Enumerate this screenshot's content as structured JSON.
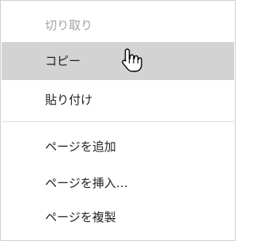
{
  "context_menu": {
    "items": [
      {
        "label": "切り取り",
        "state": "disabled"
      },
      {
        "label": "コピー",
        "state": "hover"
      },
      {
        "label": "貼り付け",
        "state": "normal"
      },
      {
        "label": "ページを追加",
        "state": "normal"
      },
      {
        "label": "ページを挿入…",
        "state": "normal"
      },
      {
        "label": "ページを複製",
        "state": "normal"
      }
    ]
  },
  "cursor": {
    "icon": "hand-pointer-icon"
  },
  "colors": {
    "hover_background": "#d3d3d3",
    "disabled_text": "#a3a3a3",
    "text": "#222222",
    "border": "#cfcfcf"
  }
}
